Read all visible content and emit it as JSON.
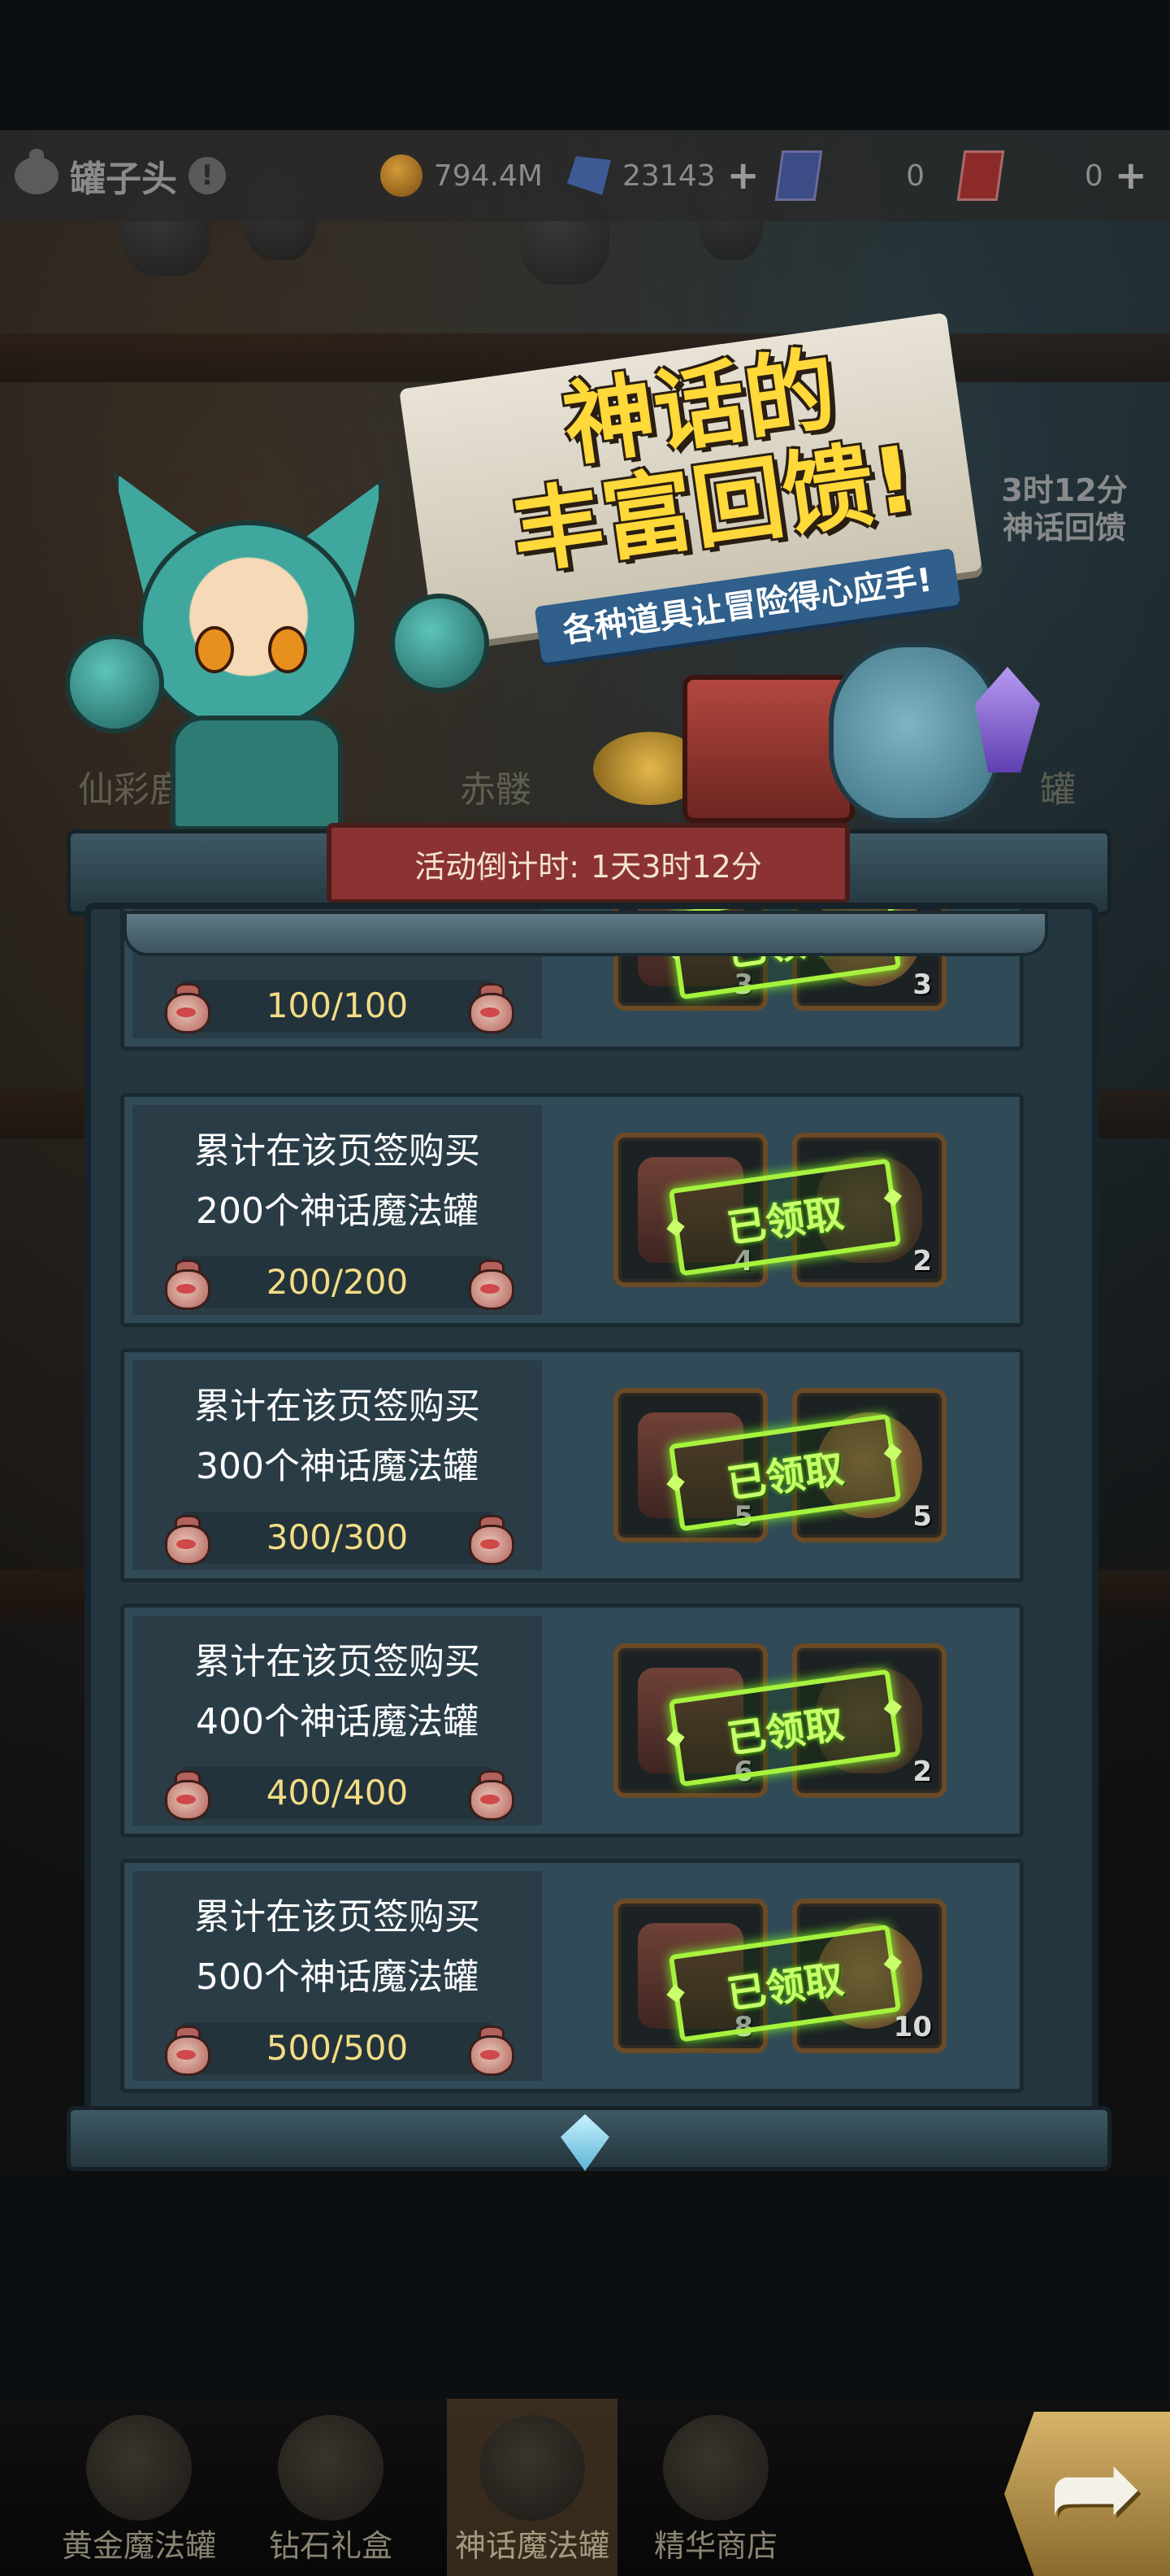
{
  "topbar": {
    "player_name": "罐子头",
    "gold": "794.4M",
    "gems": "23143",
    "blue_tickets": "0",
    "red_tickets": "0"
  },
  "background_labels": [
    "仙彩鹿",
    "赤髅",
    "罐"
  ],
  "side_badge": {
    "line1": "3时12分",
    "line2": "神话回馈"
  },
  "banner": {
    "title_line1": "神话的",
    "title_line2": "丰富回馈!",
    "subtitle": "各种道具让冒险得心应手!"
  },
  "countdown": {
    "label": "活动倒计时:",
    "value": "1天3时12分"
  },
  "tiers": [
    {
      "desc1": "",
      "desc2": "",
      "progress": "100/100",
      "rewards": [
        {
          "icon": "chest",
          "count": "3"
        },
        {
          "icon": "cookie",
          "count": "3"
        }
      ],
      "claimed": "已领取"
    },
    {
      "desc1": "累计在该页签购买",
      "desc2": "200个神话魔法罐",
      "progress": "200/200",
      "rewards": [
        {
          "icon": "chest",
          "count": "4"
        },
        {
          "icon": "bag",
          "count": "2"
        }
      ],
      "claimed": "已领取"
    },
    {
      "desc1": "累计在该页签购买",
      "desc2": "300个神话魔法罐",
      "progress": "300/300",
      "rewards": [
        {
          "icon": "chest",
          "count": "5"
        },
        {
          "icon": "cookie",
          "count": "5"
        }
      ],
      "claimed": "已领取"
    },
    {
      "desc1": "累计在该页签购买",
      "desc2": "400个神话魔法罐",
      "progress": "400/400",
      "rewards": [
        {
          "icon": "chest",
          "count": "6"
        },
        {
          "icon": "bag",
          "count": "2"
        }
      ],
      "claimed": "已领取"
    },
    {
      "desc1": "累计在该页签购买",
      "desc2": "500个神话魔法罐",
      "progress": "500/500",
      "rewards": [
        {
          "icon": "chest",
          "count": "8"
        },
        {
          "icon": "cookie",
          "count": "10"
        }
      ],
      "claimed": "已领取"
    }
  ],
  "tabs": [
    {
      "label": "黄金魔法罐",
      "active": false
    },
    {
      "label": "钻石礼盒",
      "active": false
    },
    {
      "label": "神话魔法罐",
      "active": true
    },
    {
      "label": "精华商店",
      "active": false
    }
  ],
  "icons": {
    "gold": "coin-icon",
    "gems": "gem-icon",
    "add": "plus-icon",
    "next": "arrow-icon"
  },
  "colors": {
    "claimed_green": "#a6f23e",
    "progress_text": "#f3dc86",
    "countdown_bg": "#8b3333",
    "banner_title": "#ffd83a"
  }
}
